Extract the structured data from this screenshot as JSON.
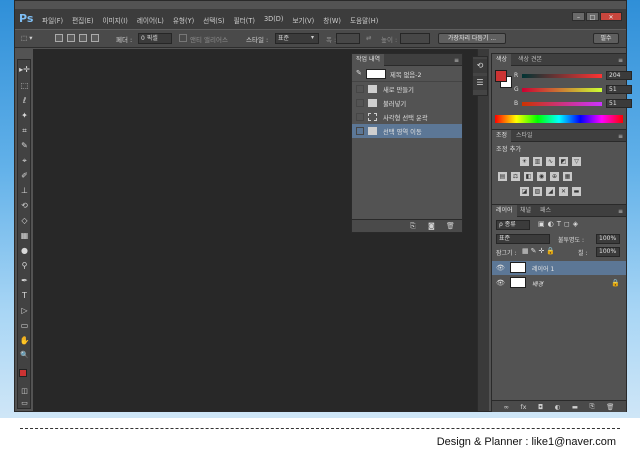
{
  "app": {
    "logo": "Ps",
    "menu": [
      "파일(F)",
      "편집(E)",
      "이미지(I)",
      "레이어(L)",
      "유형(Y)",
      "선택(S)",
      "필터(T)",
      "3D(D)",
      "보기(V)",
      "창(W)",
      "도움말(H)"
    ],
    "window_controls": [
      "–",
      "□",
      "✕"
    ]
  },
  "options_bar": {
    "feather_label": "페더 :",
    "feather_value": "0 픽셀",
    "antialias_label": "앤티 앨리어스",
    "style_label": "스타일 :",
    "style_value": "표준",
    "width_label": "폭 :",
    "height_label": "높이 :",
    "refine_edge_button": "가장자리 다듬기 ...",
    "workspace_button": "필수"
  },
  "toolbar": {
    "tools": [
      "▸✛",
      "⬚",
      "ℓ",
      "✦",
      "⌗",
      "✎",
      "⌖",
      "✐",
      "⊥",
      "⟲",
      "◇",
      "▦",
      "●",
      "⚲",
      "✒",
      "T",
      "▷",
      "▭",
      "✋",
      "🔍"
    ]
  },
  "history_panel": {
    "tabs": [
      "작업 내역"
    ],
    "snapshot_label": "제목 없음-2",
    "items": [
      {
        "label": "새로 만들기",
        "selected": false
      },
      {
        "label": "불러넣기",
        "selected": false
      },
      {
        "label": "사각형 선택 윤곽",
        "selected": false
      },
      {
        "label": "선택 영역 이동",
        "selected": true
      }
    ]
  },
  "color_panel": {
    "tabs": [
      "색상",
      "색상 견본"
    ],
    "channels": [
      {
        "label": "R",
        "value": "204"
      },
      {
        "label": "G",
        "value": "51"
      },
      {
        "label": "B",
        "value": "51"
      }
    ],
    "fg_color": "#cc3333",
    "bg_color": "#ffffff"
  },
  "adjustments_panel": {
    "tabs": [
      "조정",
      "스타일"
    ],
    "heading": "조정 추가"
  },
  "layers_panel": {
    "tabs": [
      "레이어",
      "채널",
      "패스"
    ],
    "filter_label": "ρ 종류",
    "blend_mode": "표준",
    "opacity_label": "불투명도 :",
    "opacity_value": "100%",
    "lock_label": "잠그기 :",
    "fill_label": "칠 :",
    "fill_value": "100%",
    "layers": [
      {
        "name": "레이어 1",
        "selected": true,
        "locked": false
      },
      {
        "name": "배경",
        "selected": false,
        "locked": true
      }
    ]
  },
  "footer": {
    "credit": "Design & Planner : like1@naver.com"
  }
}
